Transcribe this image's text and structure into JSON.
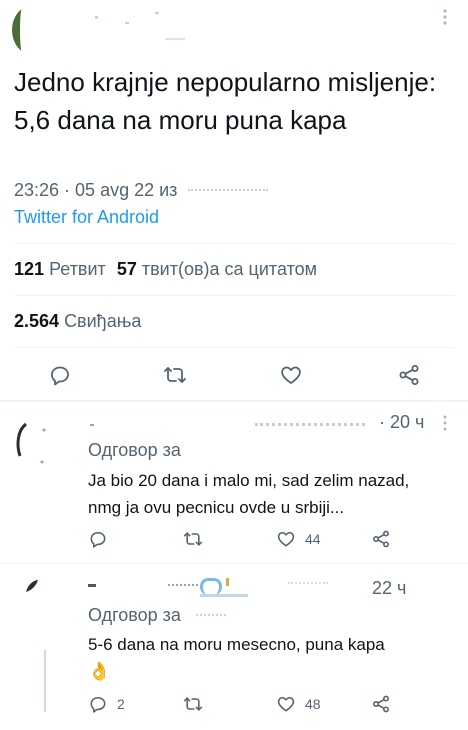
{
  "tweet": {
    "text": "Jedno krajnje nepopularno misljenje: 5,6 dana na moru puna kapa",
    "meta": "23:26 · 05 avg 22 из",
    "client": "Twitter for Android",
    "retweets_count": "121",
    "retweets_label": "Ретвит",
    "quotes_count": "57",
    "quotes_label": "твит(ов)а са цитатом",
    "likes_count": "2.564",
    "likes_label": "Свиђања",
    "more_icon": "more-vertical-icon"
  },
  "replies": [
    {
      "time": "· 20 ч",
      "replying_to": "Одговор за",
      "text_line1": "Ja bio 20 dana i malo mi, sad zelim nazad,",
      "text_line2": "nmg ja ovu pecnicu ovde u srbiji...",
      "reply_count": "",
      "retweet_count": "",
      "like_count": "44"
    },
    {
      "time": "22 ч",
      "replying_to": "Одговор за",
      "text_line1": "5-6 dana na moru mesecno, puna kapa",
      "emoji": "👌",
      "reply_count": "2",
      "retweet_count": "",
      "like_count": "48"
    }
  ],
  "colors": {
    "accent": "#1d9bf0",
    "secondary_text": "#536471",
    "divider": "#eff3f4"
  }
}
